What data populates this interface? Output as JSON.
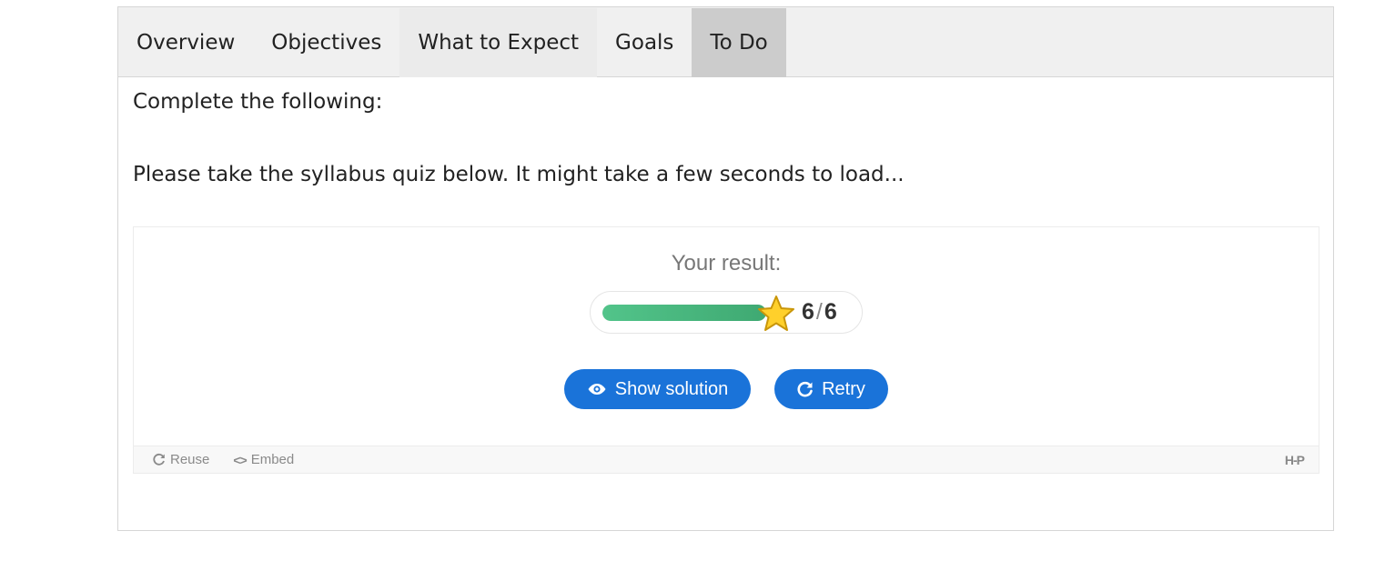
{
  "tabs": [
    {
      "label": "Overview",
      "state": "default"
    },
    {
      "label": "Objectives",
      "state": "default"
    },
    {
      "label": "What to Expect",
      "state": "hover"
    },
    {
      "label": "Goals",
      "state": "default"
    },
    {
      "label": "To Do",
      "state": "active"
    }
  ],
  "panel": {
    "intro": "Complete the following:",
    "instructions": "Please take the syllabus quiz below. It might take a few seconds to load..."
  },
  "quiz": {
    "result_label": "Your result:",
    "score": "6",
    "max_score": "6",
    "separator": "/",
    "progress_fraction": 1.0,
    "star_icon": "star-icon",
    "buttons": {
      "show_solution": "Show solution",
      "retry": "Retry"
    },
    "footer": {
      "reuse": "Reuse",
      "embed": "Embed",
      "logo": "H-P"
    }
  },
  "colors": {
    "accent": "#1a73d9",
    "progress": "#4cba82",
    "star": "#ffd02b",
    "tab_active": "#cccccc"
  }
}
